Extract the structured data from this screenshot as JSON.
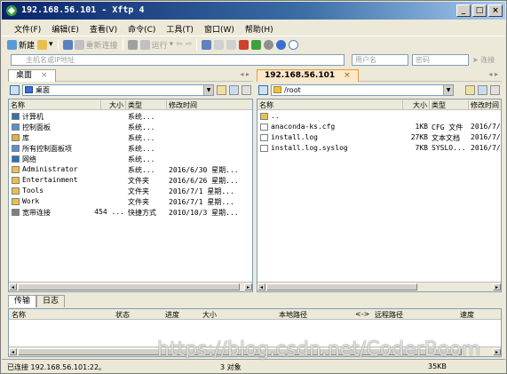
{
  "window": {
    "title": "192.168.56.101 - Xftp 4",
    "buttons": [
      "_",
      "□",
      "×"
    ]
  },
  "menu": [
    "文件(F)",
    "编辑(E)",
    "查看(V)",
    "命令(C)",
    "工具(T)",
    "窗口(W)",
    "帮助(H)"
  ],
  "toolbar": {
    "new_label": "新建",
    "reconnect_label": "重新连接",
    "run_label": "运行"
  },
  "address": {
    "host_placeholder": "主机名或IP地址",
    "user_placeholder": "用户名",
    "password_placeholder": "密码",
    "connect_label": "连接"
  },
  "left_pane": {
    "tab": "桌面",
    "path": "桌面",
    "columns": [
      "名称",
      "大小",
      "类型",
      "修改时间"
    ],
    "rows": [
      {
        "name": "计算机",
        "size": "",
        "type": "系统...",
        "modified": "",
        "icon": "computer-icon",
        "color": "#3a6ea5"
      },
      {
        "name": "控制面板",
        "size": "",
        "type": "系统...",
        "modified": "",
        "icon": "control-panel-icon",
        "color": "#5a8ed0"
      },
      {
        "name": "库",
        "size": "",
        "type": "系统...",
        "modified": "",
        "icon": "library-icon",
        "color": "#e0b040"
      },
      {
        "name": "所有控制面板项",
        "size": "",
        "type": "系统...",
        "modified": "",
        "icon": "control-panel-icon",
        "color": "#5a8ed0"
      },
      {
        "name": "网络",
        "size": "",
        "type": "系统...",
        "modified": "",
        "icon": "network-icon",
        "color": "#2a70c0"
      },
      {
        "name": "Administrator",
        "size": "",
        "type": "系统...",
        "modified": "2016/6/30 星期...",
        "icon": "user-folder-icon",
        "color": "#e8c050"
      },
      {
        "name": "Entertainment",
        "size": "",
        "type": "文件夹",
        "modified": "2016/6/26 星期...",
        "icon": "folder-icon",
        "color": "#e8c050"
      },
      {
        "name": "Tools",
        "size": "",
        "type": "文件夹",
        "modified": "2016/7/1 星期...",
        "icon": "folder-icon",
        "color": "#e8c050"
      },
      {
        "name": "Work",
        "size": "",
        "type": "文件夹",
        "modified": "2016/7/1 星期...",
        "icon": "folder-icon",
        "color": "#e8c050"
      },
      {
        "name": "宽带连接",
        "size": "454 ...",
        "type": "快捷方式",
        "modified": "2010/10/3 星期...",
        "icon": "broadband-icon",
        "color": "#808080"
      }
    ]
  },
  "right_pane": {
    "tab": "192.168.56.101",
    "path": "/root",
    "columns": [
      "名称",
      "大小",
      "类型",
      "修改时间"
    ],
    "rows": [
      {
        "name": "..",
        "size": "",
        "type": "",
        "modified": "",
        "icon": "parent-folder-icon",
        "color": "#e8c050"
      },
      {
        "name": "anaconda-ks.cfg",
        "size": "1KB",
        "type": "CFG 文件",
        "modified": "2016/7/...",
        "icon": "file-icon",
        "color": "#ffffff"
      },
      {
        "name": "install.log",
        "size": "27KB",
        "type": "文本文档",
        "modified": "2016/7/...",
        "icon": "file-icon",
        "color": "#ffffff"
      },
      {
        "name": "install.log.syslog",
        "size": "7KB",
        "type": "SYSLO...",
        "modified": "2016/7/...",
        "icon": "file-icon",
        "color": "#ffffff"
      }
    ]
  },
  "transfer": {
    "tabs": [
      "传输",
      "日志"
    ],
    "columns": [
      "名称",
      "状态",
      "进度",
      "大小",
      "本地路径",
      "<->",
      "远程路径",
      "速度"
    ]
  },
  "status": {
    "connection": "已连接 192.168.56.101:22。",
    "objects": "3 对象",
    "size": "35KB"
  },
  "watermark": "https://blog.csdn.net/CoderBoom"
}
